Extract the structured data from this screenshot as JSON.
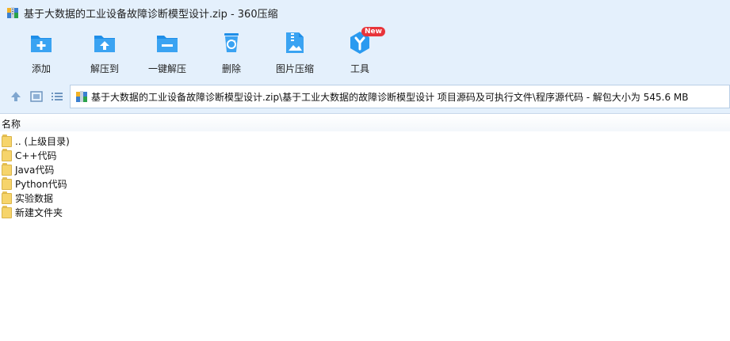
{
  "window": {
    "title": "基于大数据的工业设备故障诊断模型设计.zip - 360压缩",
    "app_icon": "archive-icon"
  },
  "toolbar": {
    "items": [
      {
        "label": "添加",
        "icon": "add-icon"
      },
      {
        "label": "解压到",
        "icon": "extract-to-icon"
      },
      {
        "label": "一键解压",
        "icon": "one-click-extract-icon"
      },
      {
        "label": "删除",
        "icon": "delete-icon"
      },
      {
        "label": "图片压缩",
        "icon": "image-compress-icon"
      },
      {
        "label": "工具",
        "icon": "tools-icon",
        "badge": "New"
      }
    ]
  },
  "address": {
    "path": "基于大数据的工业设备故障诊断模型设计.zip\\基于工业大数据的故障诊断模型设计 项目源码及可执行文件\\程序源代码 - 解包大小为 545.6 MB"
  },
  "columns": {
    "name": "名称"
  },
  "files": [
    {
      "name": ".. (上级目录)"
    },
    {
      "name": "C++代码"
    },
    {
      "name": "Java代码"
    },
    {
      "name": "Python代码"
    },
    {
      "name": "实验数据"
    },
    {
      "name": "新建文件夹"
    }
  ],
  "colors": {
    "chrome_bg": "#e4f0fc",
    "icon_blue": "#1e8ee8",
    "folder_yellow": "#f6d46b",
    "badge_red": "#e8343a"
  }
}
